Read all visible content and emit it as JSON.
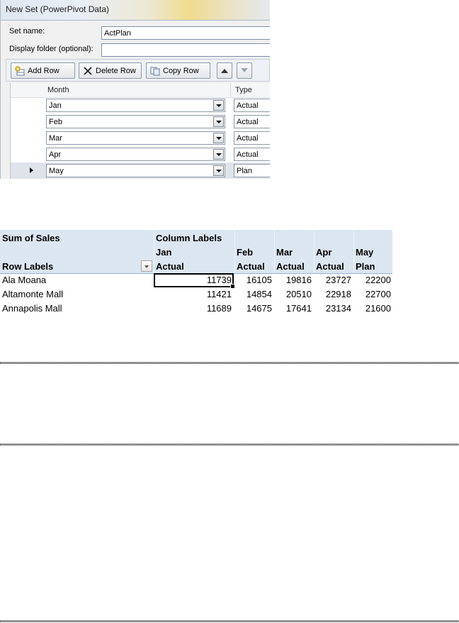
{
  "dialog": {
    "title": "New Set (PowerPivot Data)",
    "set_name_label": "Set name:",
    "set_name_value": "ActPlan",
    "display_folder_label": "Display folder (optional):",
    "display_folder_value": "",
    "toolbar": {
      "add_row": "Add Row",
      "delete_row": "Delete Row",
      "copy_row": "Copy Row"
    },
    "grid": {
      "columns": [
        "Month",
        "Type"
      ],
      "rows": [
        {
          "month": "Jan",
          "type": "Actual"
        },
        {
          "month": "Feb",
          "type": "Actual"
        },
        {
          "month": "Mar",
          "type": "Actual"
        },
        {
          "month": "Apr",
          "type": "Actual"
        },
        {
          "month": "May",
          "type": "Plan"
        }
      ],
      "selected_row": 4
    }
  },
  "pivot": {
    "values_label": "Sum of Sales",
    "column_labels": "Column Labels",
    "row_labels": "Row Labels",
    "columns": [
      {
        "month": "Jan",
        "type": "Actual"
      },
      {
        "month": "Feb",
        "type": "Actual"
      },
      {
        "month": "Mar",
        "type": "Actual"
      },
      {
        "month": "Apr",
        "type": "Actual"
      },
      {
        "month": "May",
        "type": "Plan"
      }
    ],
    "rows": [
      {
        "label": "Ala Moana",
        "values": [
          "11739",
          "16105",
          "19816",
          "23727",
          "22200"
        ]
      },
      {
        "label": "Altamonte Mall",
        "values": [
          "11421",
          "14854",
          "20510",
          "22918",
          "22700"
        ]
      },
      {
        "label": "Annapolis Mall",
        "values": [
          "11689",
          "14675",
          "17641",
          "23134",
          "21600"
        ]
      }
    ]
  },
  "icons": {
    "add": "add-row-icon",
    "delete": "delete-x-icon",
    "copy": "copy-icon",
    "up": "arrow-up-icon",
    "down": "arrow-down-icon",
    "filter": "filter-dropdown-icon"
  }
}
